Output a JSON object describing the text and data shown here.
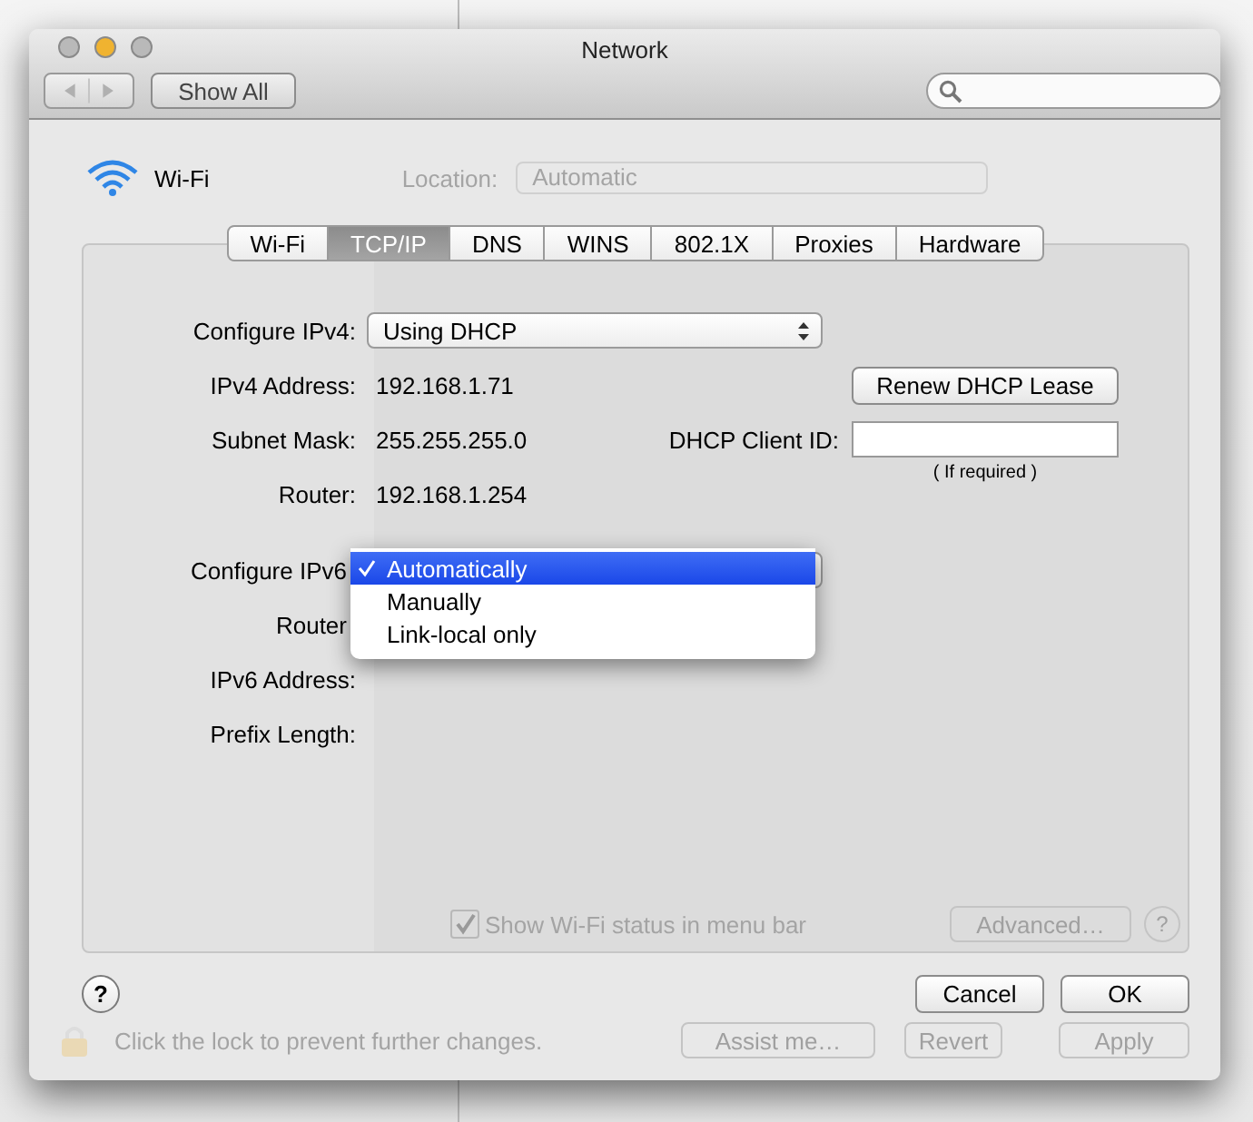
{
  "window": {
    "title": "Network",
    "traffic_lights": [
      {
        "color": "#b9b9b9"
      },
      {
        "color": "#f0b330"
      },
      {
        "color": "#b9b9b9"
      }
    ]
  },
  "toolbar": {
    "show_all": "Show All"
  },
  "header": {
    "service": "Wi-Fi",
    "location_label": "Location:",
    "location_value": "Automatic"
  },
  "tabs": [
    {
      "label": "Wi-Fi",
      "selected": false
    },
    {
      "label": "TCP/IP",
      "selected": true
    },
    {
      "label": "DNS",
      "selected": false
    },
    {
      "label": "WINS",
      "selected": false
    },
    {
      "label": "802.1X",
      "selected": false
    },
    {
      "label": "Proxies",
      "selected": false
    },
    {
      "label": "Hardware",
      "selected": false
    }
  ],
  "ipv4": {
    "configure_label": "Configure IPv4:",
    "configure_value": "Using DHCP",
    "rows": [
      {
        "label": "IPv4 Address:",
        "value": "192.168.1.71"
      },
      {
        "label": "Subnet Mask:",
        "value": "255.255.255.0"
      },
      {
        "label": "Router:",
        "value": "192.168.1.254"
      }
    ],
    "renew_button": "Renew DHCP Lease",
    "client_id_label": "DHCP Client ID:",
    "client_id_hint": "( If required )"
  },
  "ipv6": {
    "configure_label": "Configure IPv6",
    "menu": [
      {
        "label": "Automatically",
        "selected": true,
        "checked": true
      },
      {
        "label": "Manually",
        "selected": false,
        "checked": false
      },
      {
        "label": "Link-local only",
        "selected": false,
        "checked": false
      }
    ],
    "rows": [
      {
        "label": "Router"
      },
      {
        "label": "IPv6 Address:"
      },
      {
        "label": "Prefix Length:"
      }
    ]
  },
  "background": {
    "show_status": {
      "label": "Show Wi-Fi status in menu bar",
      "checked": true
    },
    "advanced": "Advanced…",
    "help": "?",
    "lock_text": "Click the lock to prevent further changes.",
    "assist": "Assist me…",
    "revert": "Revert",
    "apply": "Apply"
  },
  "buttons": {
    "help": "?",
    "cancel": "Cancel",
    "ok": "OK"
  }
}
